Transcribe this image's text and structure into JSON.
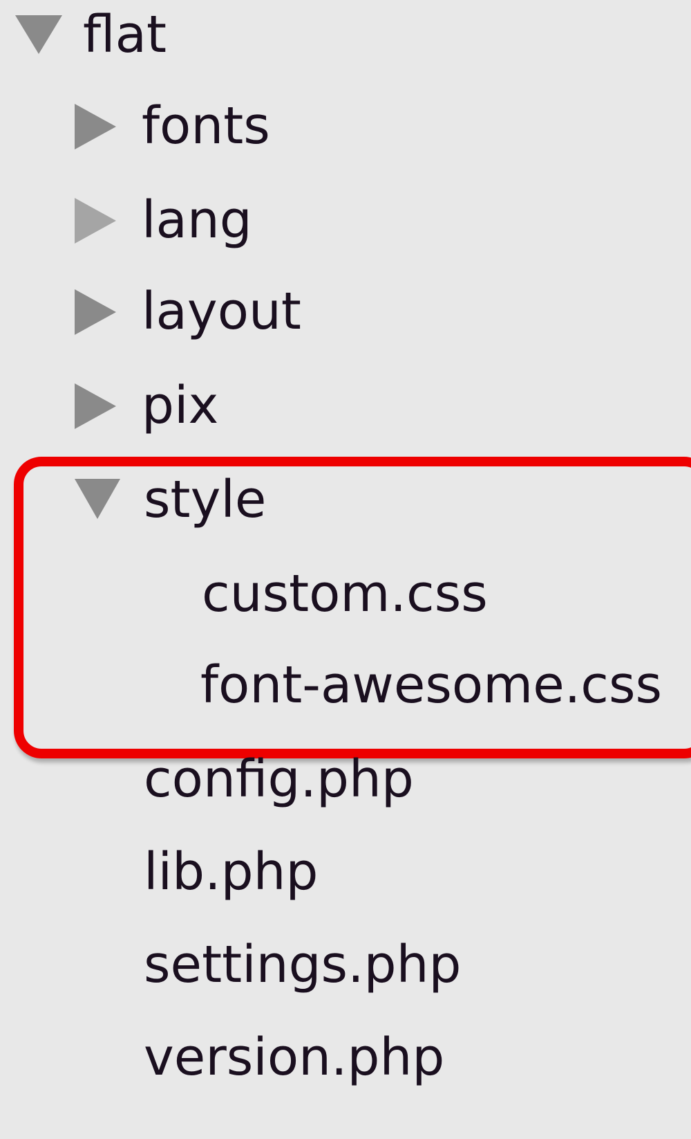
{
  "tree": {
    "root": {
      "label": "flat",
      "expanded": true,
      "icon": "triangle-down-icon"
    },
    "folders": [
      {
        "label": "fonts",
        "expanded": false,
        "icon": "triangle-right-icon"
      },
      {
        "label": "lang",
        "expanded": false,
        "icon": "triangle-right-icon"
      },
      {
        "label": "layout",
        "expanded": false,
        "icon": "triangle-right-icon"
      },
      {
        "label": "pix",
        "expanded": false,
        "icon": "triangle-right-icon"
      },
      {
        "label": "style",
        "expanded": true,
        "icon": "triangle-down-icon"
      }
    ],
    "style_children": [
      {
        "label": "custom.css"
      },
      {
        "label": "font-awesome.css"
      }
    ],
    "files": [
      {
        "label": "config.php"
      },
      {
        "label": "lib.php"
      },
      {
        "label": "settings.php"
      },
      {
        "label": "version.php"
      }
    ]
  },
  "colors": {
    "background": "#e8e8e8",
    "text": "#1a0f1f",
    "arrow": "#8a8a8a",
    "arrow_light": "#a5a5a5",
    "highlight": "#ee0000"
  }
}
